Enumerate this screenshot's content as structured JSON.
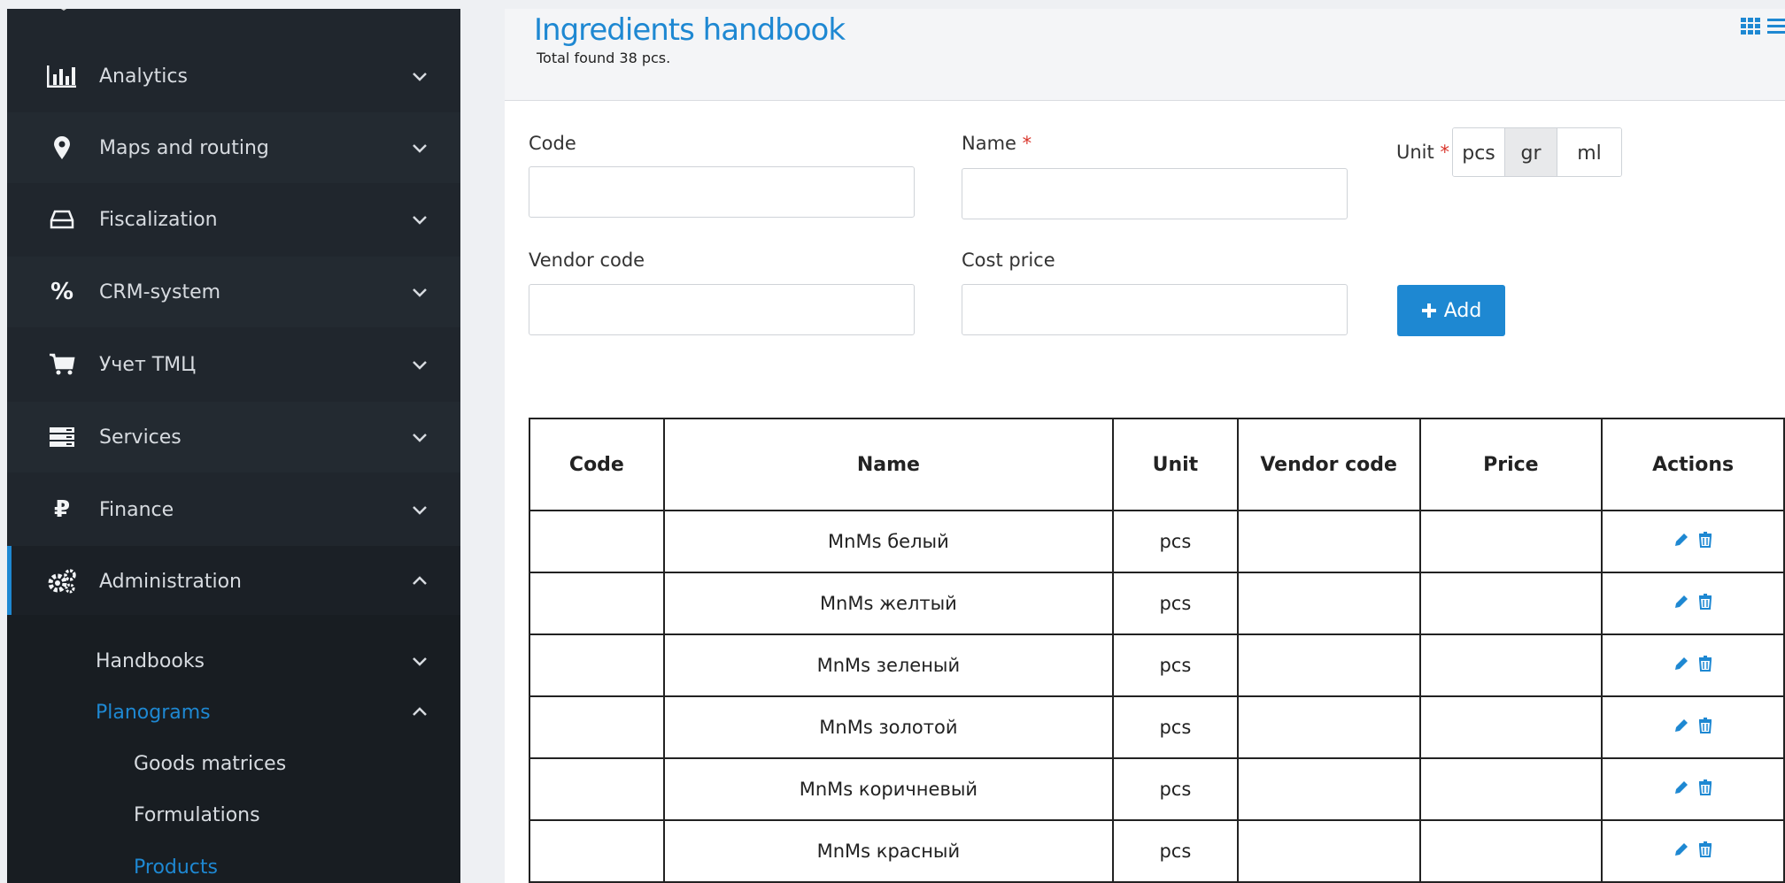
{
  "sidebar": {
    "items": [
      {
        "label": "Analytics",
        "icon": "bar-chart-icon"
      },
      {
        "label": "Maps and routing",
        "icon": "map-pin-icon"
      },
      {
        "label": "Fiscalization",
        "icon": "hard-drive-icon"
      },
      {
        "label": "CRM-system",
        "icon": "percent-icon"
      },
      {
        "label": "Учет ТМЦ",
        "icon": "cart-icon"
      },
      {
        "label": "Services",
        "icon": "server-icon"
      },
      {
        "label": "Finance",
        "icon": "ruble-icon"
      },
      {
        "label": "Administration",
        "icon": "cogs-icon"
      }
    ],
    "sub": {
      "handbooks": "Handbooks",
      "planograms": "Planograms",
      "goods_matrices": "Goods matrices",
      "formulations": "Formulations",
      "products": "Products"
    }
  },
  "header": {
    "title": "Ingredients handbook",
    "subtitle": "Total found 38 pcs."
  },
  "form": {
    "code_label": "Code",
    "name_label": "Name",
    "unit_label": "Unit",
    "required_mark": "*",
    "vendor_label": "Vendor code",
    "cost_label": "Cost price",
    "units": [
      "pcs",
      "gr",
      "ml"
    ],
    "selected_unit": "gr",
    "add_label": "Add"
  },
  "table": {
    "headers": [
      "Code",
      "Name",
      "Unit",
      "Vendor code",
      "Price",
      "Actions"
    ],
    "rows": [
      {
        "code": "",
        "name": "MnMs белый",
        "unit": "pcs",
        "vendor": "",
        "price": ""
      },
      {
        "code": "",
        "name": "MnMs желтый",
        "unit": "pcs",
        "vendor": "",
        "price": ""
      },
      {
        "code": "",
        "name": "MnMs зеленый",
        "unit": "pcs",
        "vendor": "",
        "price": ""
      },
      {
        "code": "",
        "name": "MnMs золотой",
        "unit": "pcs",
        "vendor": "",
        "price": ""
      },
      {
        "code": "",
        "name": "MnMs коричневый",
        "unit": "pcs",
        "vendor": "",
        "price": ""
      },
      {
        "code": "",
        "name": "MnMs красный",
        "unit": "pcs",
        "vendor": "",
        "price": ""
      }
    ]
  },
  "colors": {
    "accent": "#1e88d2",
    "sidebar_bg": "#20262d",
    "required": "#d9352b"
  }
}
